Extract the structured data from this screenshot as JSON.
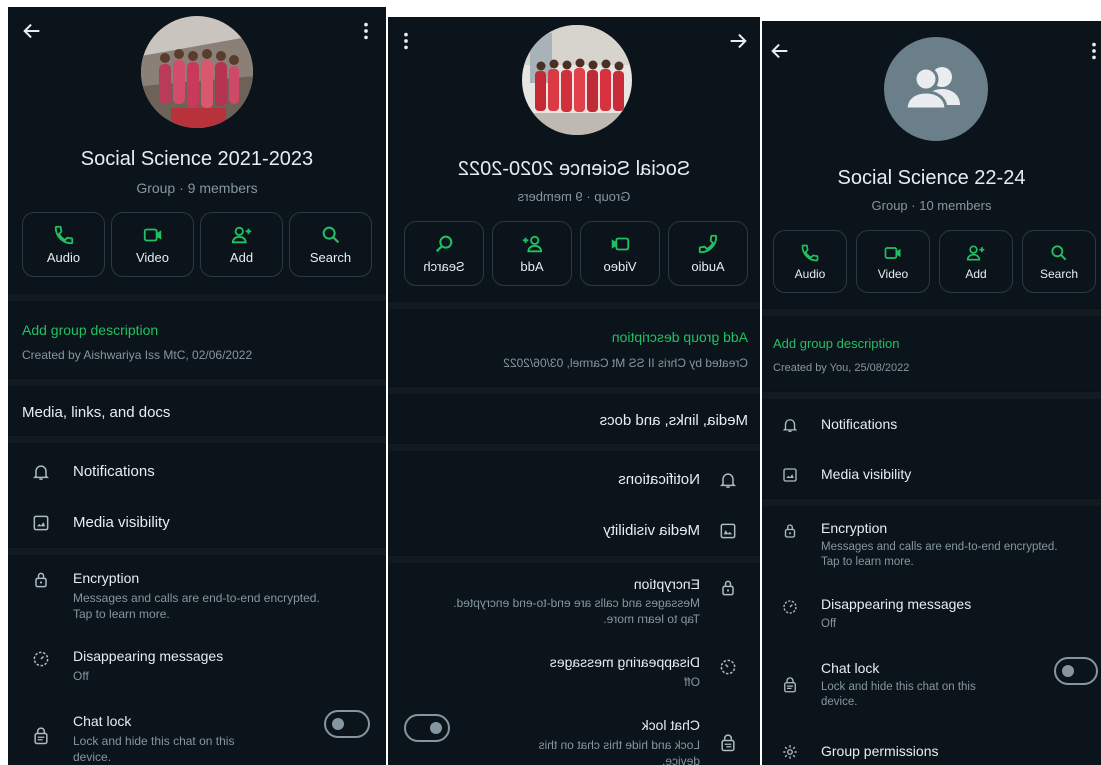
{
  "colors": {
    "background": "#0b141a",
    "accent": "#21c063",
    "muted": "#8696a0",
    "text": "#e9edef"
  },
  "panels": [
    {
      "title": "Social Science 2021-2023",
      "subtitle": "Group · 9 members",
      "actions": [
        {
          "label": "Audio",
          "icon": "phone-icon"
        },
        {
          "label": "Video",
          "icon": "video-icon"
        },
        {
          "label": "Add",
          "icon": "add-person-icon"
        },
        {
          "label": "Search",
          "icon": "search-icon"
        }
      ],
      "description_link": "Add group description",
      "created_by": "Created by Aishwariya Iss MtC, 02/06/2022",
      "media_links": "Media, links, and docs",
      "notifications": "Notifications",
      "media_visibility": "Media visibility",
      "encryption": {
        "title": "Encryption",
        "sub_line1": "Messages and calls are end-to-end encrypted.",
        "sub_line2": "Tap to learn more."
      },
      "disappearing": {
        "title": "Disappearing messages",
        "value": "Off"
      },
      "chat_lock": {
        "title": "Chat lock",
        "sub_line1": "Lock and hide this chat on this",
        "sub_line2": "device."
      }
    },
    {
      "title": "Social Science 2020-2022",
      "subtitle": "Group · 9 members",
      "actions": [
        {
          "label": "Audio",
          "icon": "phone-icon"
        },
        {
          "label": "Video",
          "icon": "video-icon"
        },
        {
          "label": "Add",
          "icon": "add-person-icon"
        },
        {
          "label": "Search",
          "icon": "search-icon"
        }
      ],
      "description_link": "Add group description",
      "created_by": "Created by Chris II SS Mt Carmel, 03/06/2022",
      "media_links": "Media, links, and docs",
      "notifications": "Notifications",
      "media_visibility": "Media visibility",
      "encryption": {
        "title": "Encryption",
        "sub_line1": "Messages and calls are end-to-end encrypted.",
        "sub_line2": "Tap to learn more."
      },
      "disappearing": {
        "title": "Disappearing messages",
        "value": "Off"
      },
      "chat_lock": {
        "title": "Chat lock",
        "sub_line1": "Lock and hide this chat on this",
        "sub_line2": "device."
      }
    },
    {
      "title": "Social Science 22-24",
      "subtitle": "Group · 10 members",
      "actions": [
        {
          "label": "Audio",
          "icon": "phone-icon"
        },
        {
          "label": "Video",
          "icon": "video-icon"
        },
        {
          "label": "Add",
          "icon": "add-person-icon"
        },
        {
          "label": "Search",
          "icon": "search-icon"
        }
      ],
      "description_link": "Add group description",
      "created_by": "Created by You, 25/08/2022",
      "notifications": "Notifications",
      "media_visibility": "Media visibility",
      "encryption": {
        "title": "Encryption",
        "sub_line1": "Messages and calls are end-to-end encrypted.",
        "sub_line2": "Tap to learn more."
      },
      "disappearing": {
        "title": "Disappearing messages",
        "value": "Off"
      },
      "chat_lock": {
        "title": "Chat lock",
        "sub_line1": "Lock and hide this chat on this",
        "sub_line2": "device."
      },
      "group_permissions": "Group permissions"
    }
  ]
}
